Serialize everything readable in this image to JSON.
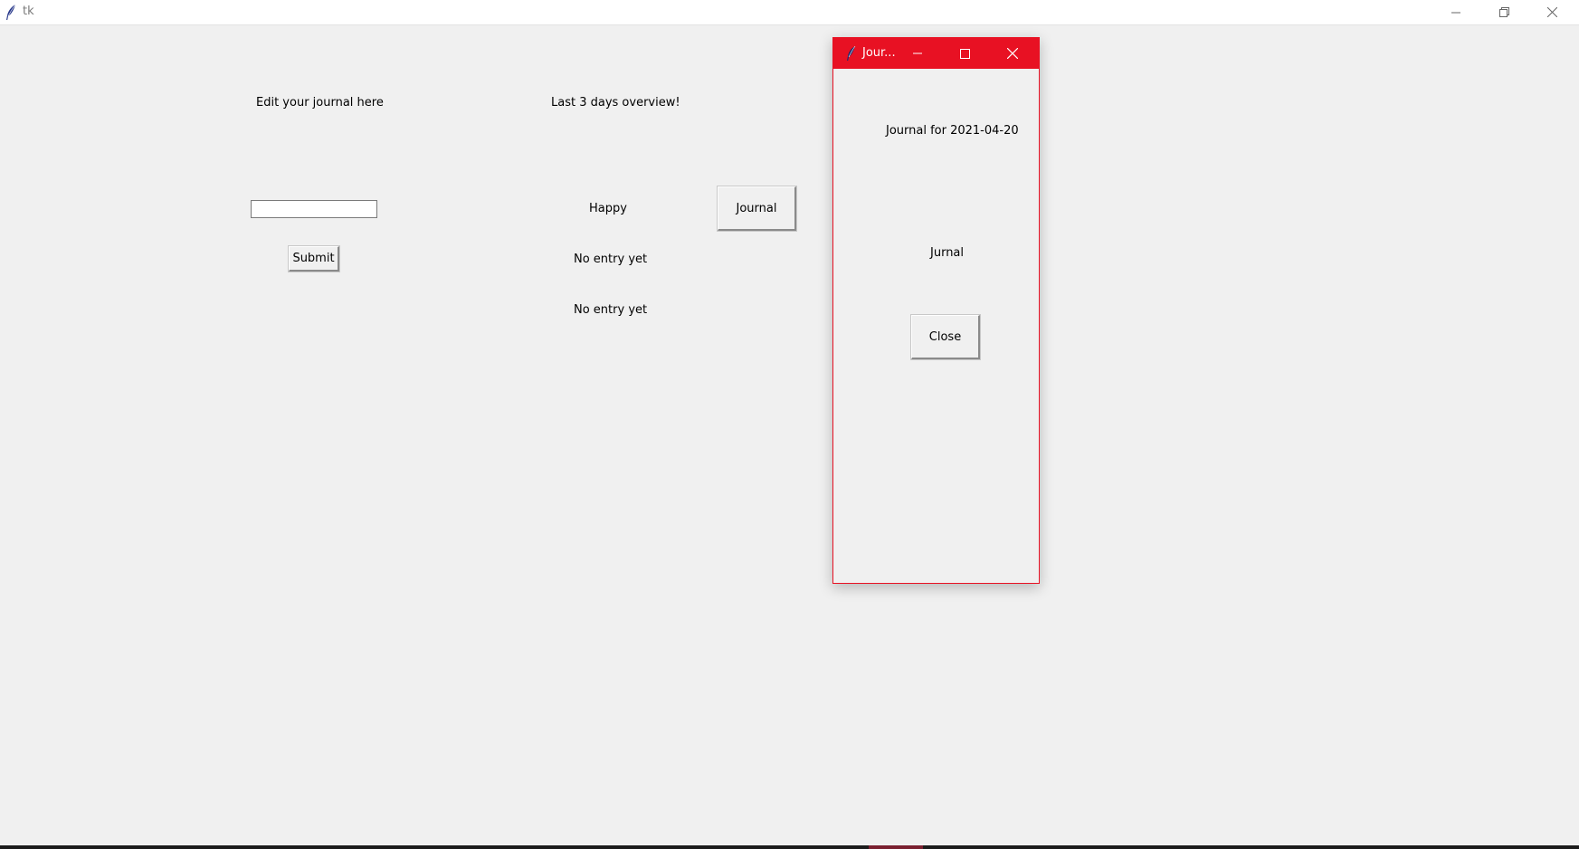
{
  "main_window": {
    "title": "tk",
    "edit_label": "Edit your journal here",
    "overview_label": "Last 3 days overview!",
    "entry_value": "",
    "submit_label": "Submit",
    "overview_items": [
      "Happy",
      "No entry yet",
      "No entry yet"
    ],
    "journal_button_label": "Journal"
  },
  "dialog": {
    "title": "Jour...",
    "heading": "Journal for 2021-04-20",
    "content": "Jurnal",
    "close_label": "Close",
    "accent_color": "#e81123"
  },
  "icons": {
    "app": "tk-feather-icon",
    "minimize": "minimize-icon",
    "restore": "restore-icon",
    "maximize": "maximize-icon",
    "close": "close-icon"
  }
}
